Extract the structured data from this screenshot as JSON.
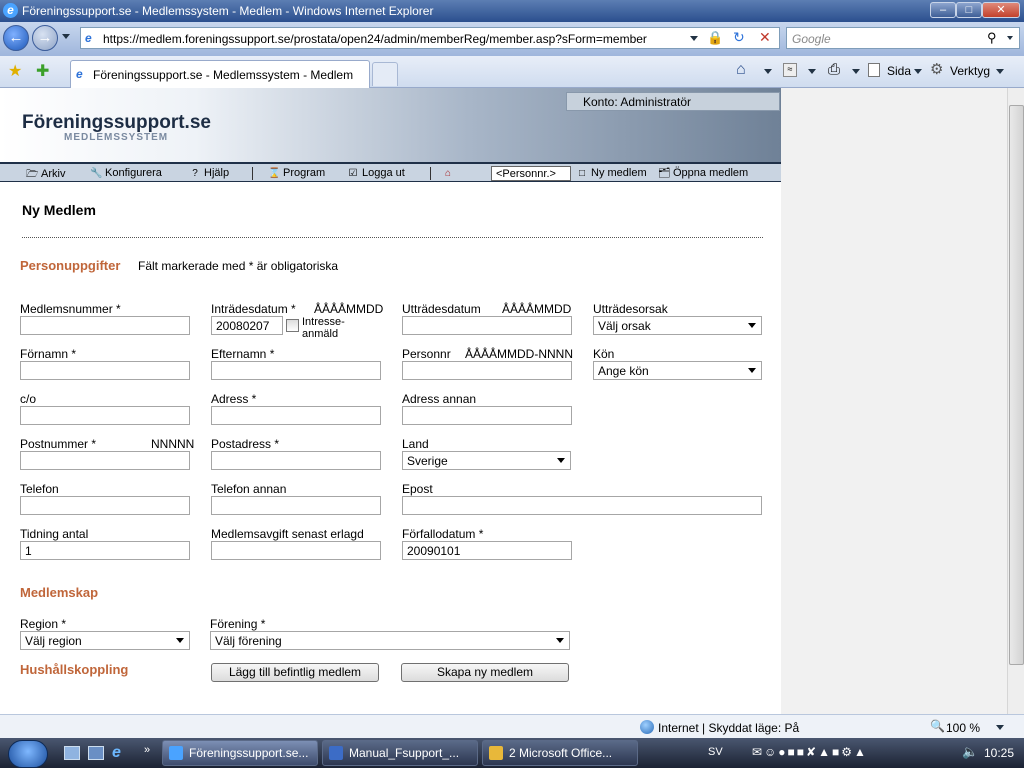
{
  "window": {
    "title": "Föreningssupport.se - Medlemssystem - Medlem - Windows Internet Explorer",
    "minimize": "–",
    "maximize": "□",
    "close": "✕"
  },
  "navigation": {
    "url": "https://medlem.foreningssupport.se/prostata/open24/admin/memberReg/member.asp?sForm=member",
    "search_placeholder": "Google"
  },
  "tabs": {
    "active": "Föreningssupport.se - Medlemssystem - Medlem"
  },
  "command_bar": {
    "page": "Sida",
    "tools": "Verktyg"
  },
  "app": {
    "account": "Konto: Administratör",
    "logo": "Föreningssupport.se",
    "logo_sub": "MEDLEMSSYSTEM",
    "menu": {
      "archive": "Arkiv",
      "configure": "Konfigurera",
      "help": "Hjälp",
      "program": "Program",
      "logout": "Logga ut",
      "personnr_placeholder": "<Personnr.>",
      "new_member": "Ny medlem",
      "open_member": "Öppna medlem"
    }
  },
  "form": {
    "title": "Ny Medlem",
    "section_personal": "Personuppgifter",
    "required_note": "Fält markerade med * är obligatoriska",
    "member_number": {
      "label": "Medlemsnummer *",
      "value": ""
    },
    "join_date": {
      "label": "Inträdesdatum *",
      "format": "ÅÅÅÅMMDD",
      "value": "20080207"
    },
    "interest_label": "Intresse-\nanmäld",
    "exit_date": {
      "label": "Utträdesdatum",
      "format": "ÅÅÅÅMMDD",
      "value": ""
    },
    "exit_reason": {
      "label": "Utträdesorsak",
      "value": "Välj orsak"
    },
    "first_name": {
      "label": "Förnamn *",
      "value": ""
    },
    "last_name": {
      "label": "Efternamn *",
      "value": ""
    },
    "personnr": {
      "label": "Personnr",
      "format": "ÅÅÅÅMMDD-NNNN",
      "value": ""
    },
    "gender": {
      "label": "Kön",
      "value": "Ange kön"
    },
    "co": {
      "label": "c/o",
      "value": ""
    },
    "address": {
      "label": "Adress *",
      "value": ""
    },
    "address_other": {
      "label": "Adress annan",
      "value": ""
    },
    "postcode": {
      "label": "Postnummer *",
      "format": "NNNNN",
      "value": ""
    },
    "postal_address": {
      "label": "Postadress *",
      "value": ""
    },
    "country": {
      "label": "Land",
      "value": "Sverige"
    },
    "phone": {
      "label": "Telefon",
      "value": ""
    },
    "phone_other": {
      "label": "Telefon annan",
      "value": ""
    },
    "email": {
      "label": "Epost",
      "value": ""
    },
    "newspaper": {
      "label": "Tidning antal",
      "value": "1"
    },
    "fee_paid": {
      "label": "Medlemsavgift senast erlagd",
      "value": ""
    },
    "due_date": {
      "label": "Förfallodatum *",
      "value": "20090101"
    },
    "section_membership": "Medlemskap",
    "region": {
      "label": "Region *",
      "value": "Välj region"
    },
    "association": {
      "label": "Förening *",
      "value": "Välj förening"
    },
    "section_household": "Hushållskoppling",
    "add_existing": "Lägg till befintlig medlem",
    "create_new": "Skapa ny medlem"
  },
  "status": {
    "zone": "Internet | Skyddat läge: På",
    "zoom": "100 %"
  },
  "taskbar": {
    "items": [
      "Föreningssupport.se...",
      "Manual_Fsupport_...",
      "2 Microsoft Office..."
    ],
    "lang": "SV",
    "clock": "10:25"
  }
}
